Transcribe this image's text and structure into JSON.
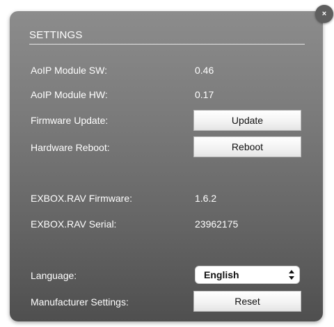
{
  "dialog": {
    "title": "SETTINGS",
    "close_label": "×"
  },
  "rows": {
    "module_sw": {
      "label": "AoIP Module SW:",
      "value": "0.46"
    },
    "module_hw": {
      "label": "AoIP Module HW:",
      "value": "0.17"
    },
    "firmware_update": {
      "label": "Firmware Update:",
      "button": "Update"
    },
    "hardware_reboot": {
      "label": "Hardware Reboot:",
      "button": "Reboot"
    },
    "exbox_firmware": {
      "label": "EXBOX.RAV Firmware:",
      "value": "1.6.2"
    },
    "exbox_serial": {
      "label": "EXBOX.RAV Serial:",
      "value": "23962175"
    },
    "language": {
      "label": "Language:",
      "selected": "English"
    },
    "manufacturer_settings": {
      "label": "Manufacturer Settings:",
      "button": "Reset"
    }
  },
  "icons": {
    "close": "close-icon",
    "select_arrows": "up-down-arrows-icon"
  }
}
